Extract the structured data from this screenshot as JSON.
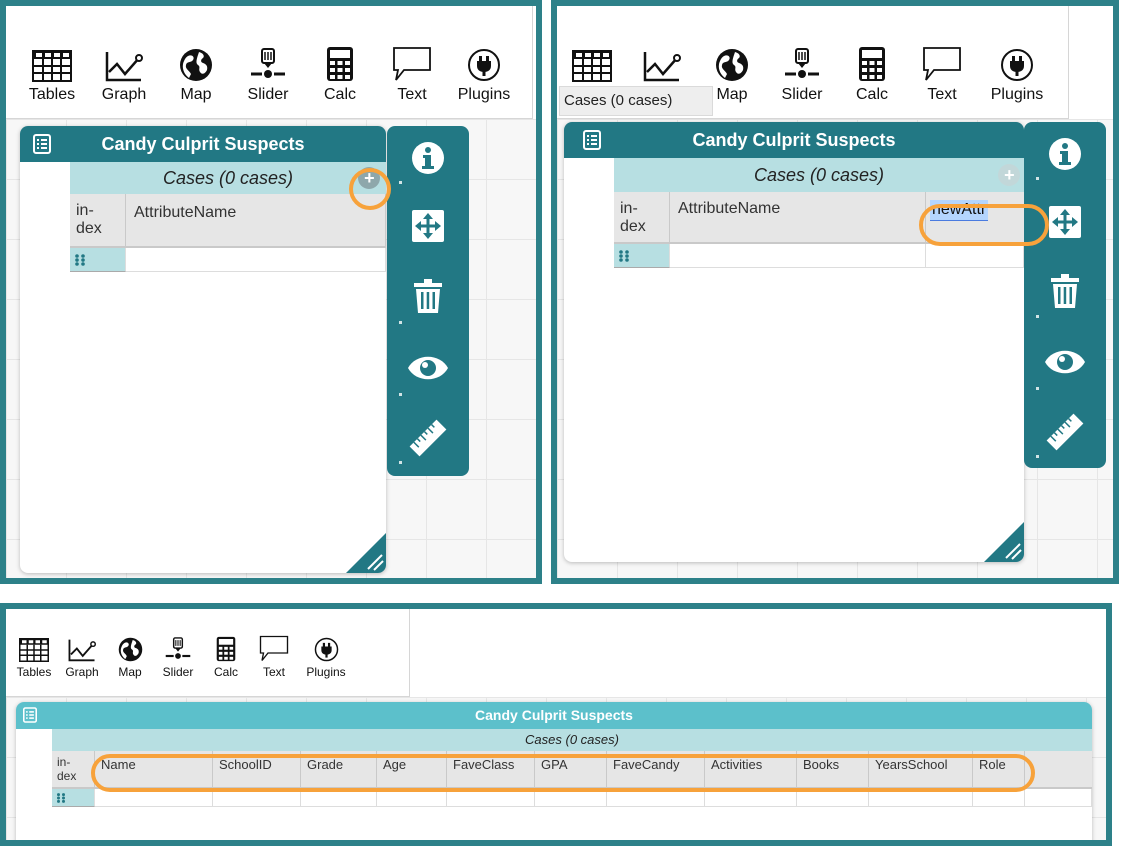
{
  "toolbar": {
    "tables": "Tables",
    "graph": "Graph",
    "map": "Map",
    "slider": "Slider",
    "calc": "Calc",
    "text": "Text",
    "plugins": "Plugins"
  },
  "table": {
    "title": "Candy Culprit Suspects",
    "subtitle": "Cases (0 cases)",
    "index_header": "in-\ndex",
    "attribute_placeholder": "AttributeName"
  },
  "panel2": {
    "tooltip": "Cases (0 cases)",
    "new_attr": "newAttr"
  },
  "panel3": {
    "columns": [
      "Name",
      "SchoolID",
      "Grade",
      "Age",
      "FaveClass",
      "GPA",
      "FaveCandy",
      "Activities",
      "Books",
      "YearsSchool",
      "Role"
    ]
  },
  "colors": {
    "frame": "#2d8189",
    "title_bar": "#227884",
    "subtitle_bar": "#b7dfe2",
    "highlight": "#f7a23b"
  }
}
